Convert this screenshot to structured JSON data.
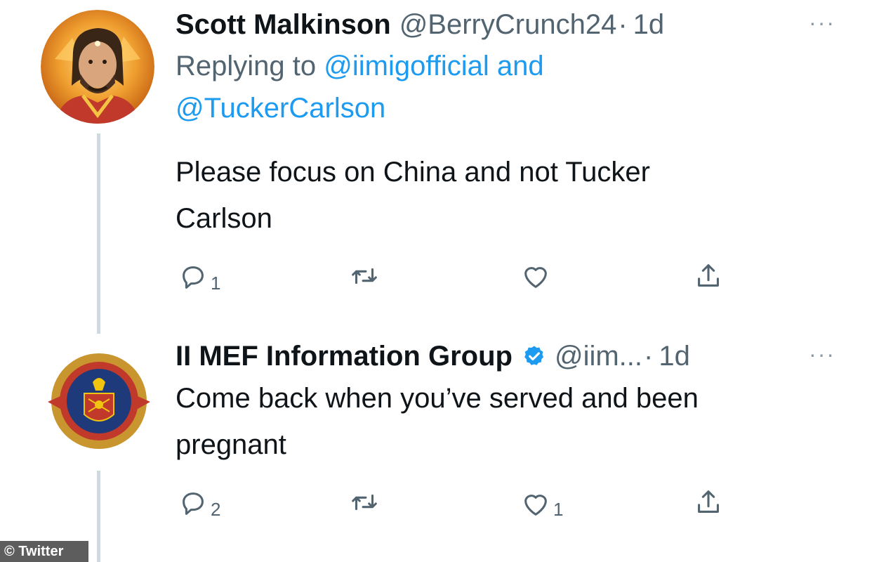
{
  "tweets": [
    {
      "name": "Scott Malkinson",
      "handle": "@BerryCrunch24",
      "dot": "·",
      "time": "1d",
      "more": "···",
      "replying_prefix": "Replying to",
      "replying_user1": "@iimigofficial",
      "replying_and": "and",
      "replying_user2": "@TuckerCarlson",
      "text_line1": "Please focus on China and not Tucker",
      "text_line2": "Carlson",
      "reply_count": "1",
      "retweet_count": "",
      "like_count": "",
      "avatar_icon": "portrait-avatar-icon"
    },
    {
      "name": "II MEF Information Group",
      "verified_icon": "verified-badge-icon",
      "handle": "@iim...",
      "dot": "·",
      "time": "1d",
      "more": "···",
      "text_line1": "Come back when you’ve served and been",
      "text_line2": "pregnant",
      "reply_count": "2",
      "retweet_count": "",
      "like_count": "1",
      "avatar_icon": "unit-emblem-avatar-icon"
    }
  ],
  "icons": {
    "reply": "reply-icon",
    "retweet": "retweet-icon",
    "like": "heart-icon",
    "share": "share-icon"
  },
  "credit": "© Twitter",
  "colors": {
    "link": "#1d9bf0",
    "secondary_text": "#536471",
    "thread_line": "#cfd9de",
    "verified": "#1d9bf0"
  }
}
